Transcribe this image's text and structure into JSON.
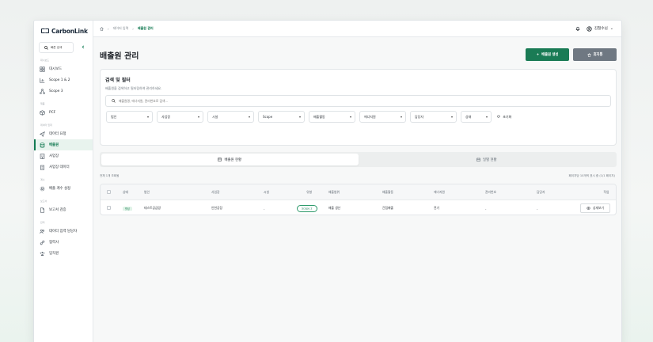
{
  "app": {
    "logo": "CarbonLink"
  },
  "sidebar": {
    "search_label": "빠른 검색",
    "groups": {
      "overview": "대시보드",
      "product": "제품",
      "data_input": "데이터 입력",
      "settings": "계수",
      "reports": "보고서",
      "management": "관리"
    },
    "items": {
      "dashboard": "대시보드",
      "scope12": "Scope 1 & 2",
      "scope3": "Scope 3",
      "pcf": "PCF",
      "data_request": "데이터 요청",
      "emission_source": "배출원",
      "site": "사업장",
      "site_data": "사업장 데이터",
      "emission_factor": "배출 계수 설정",
      "report_review": "보고서 검증",
      "data_manager": "데이터 입력 담당자",
      "partner": "협력사",
      "staff": "임직원"
    }
  },
  "topbar": {
    "breadcrumb": {
      "parent": "데이터 입력",
      "current": "배출원 관리"
    },
    "user_name": "김철수님"
  },
  "page": {
    "title": "배출원 관리",
    "create_button": "배출원 생성",
    "delete_button": "휴지통"
  },
  "filter_card": {
    "title": "검색 및 필터",
    "description": "배출원을 검색하고 필터링하여 관리하세요.",
    "search_placeholder": "배출원명, 에너지원, 관리번호로 검색...",
    "selects": {
      "corp": "법인",
      "site": "사업장",
      "facility": "시설",
      "scope": "Scope",
      "activity": "배출활동",
      "energy": "에너지원",
      "owner": "담당자",
      "status": "상태"
    },
    "reset_label": "초기화"
  },
  "tabs": {
    "current": "배출원 현황",
    "history": "일별 현황"
  },
  "summary": {
    "left": "전체 1개 조회됨",
    "right": "페이지당 10개씩 표시 중 (1/1 페이지)"
  },
  "table": {
    "headers": {
      "status": "상태",
      "corp": "법인",
      "site": "사업장",
      "facility": "시설",
      "type": "유형",
      "category": "배출범위",
      "activity": "배출활동",
      "energy": "에너지원",
      "mgmt_no": "관리번호",
      "owner": "담당자",
      "action": "작업"
    },
    "rows": [
      {
        "status": "활성",
        "corp": "테스트공급망",
        "site": "인천공장",
        "facility": "-",
        "type": "Scope 2",
        "category": "배출 생산",
        "activity": "간접배출",
        "energy": "전기",
        "mgmt_no": "-",
        "owner": "-",
        "action": "상세보기"
      }
    ]
  }
}
